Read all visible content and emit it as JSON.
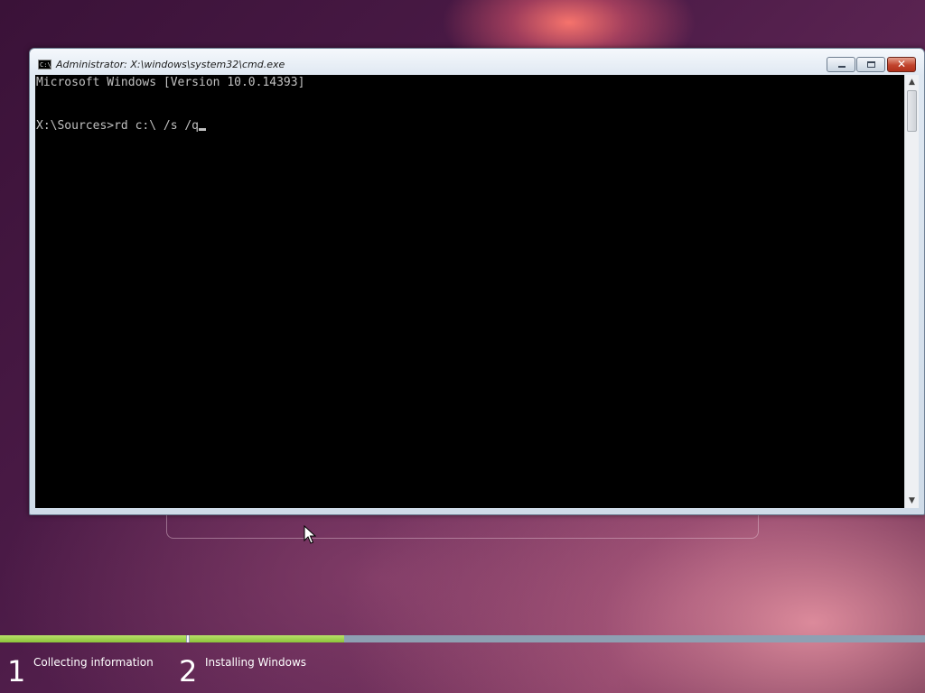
{
  "window": {
    "title": "Administrator: X:\\windows\\system32\\cmd.exe",
    "icon": "cmd-icon",
    "icon_glyph": "C:\\",
    "buttons": {
      "minimize": "minimize-icon",
      "maximize": "maximize-icon",
      "close": "close-icon",
      "close_glyph": "✕"
    }
  },
  "console": {
    "lines": [
      "Microsoft Windows [Version 10.0.14393]",
      "",
      "X:\\Sources>rd c:\\ /s /q"
    ]
  },
  "scrollbar": {
    "up_glyph": "▲",
    "down_glyph": "▼"
  },
  "setup": {
    "steps": [
      {
        "number": "1",
        "label": "Collecting information"
      },
      {
        "number": "2",
        "label": "Installing Windows"
      }
    ],
    "progress": {
      "step1_complete": 1.0,
      "step2_fraction": 0.21
    },
    "colors": {
      "progress_fill": "#8cc43a",
      "progress_track": "#8ea0b3"
    }
  }
}
